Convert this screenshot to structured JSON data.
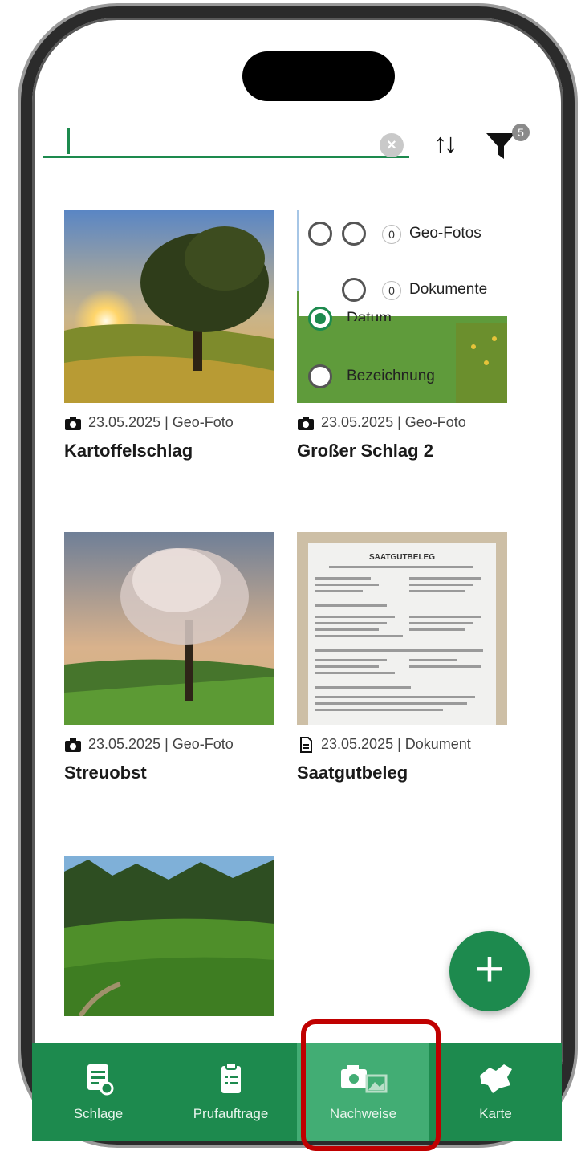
{
  "search": {
    "value": "",
    "placeholder": ""
  },
  "filter": {
    "badge_count": "5"
  },
  "sort_options": [
    {
      "label": "Datum",
      "selected": true
    },
    {
      "label": "Bezeichnung",
      "selected": false
    }
  ],
  "filter_options": [
    {
      "count": "0",
      "label": "Geo-Fotos"
    },
    {
      "count": "0",
      "label": "Dokumente"
    }
  ],
  "items": [
    {
      "meta": "23.05.2025 | Geo-Foto",
      "title": "Kartoffelschlag",
      "icon": "camera-icon"
    },
    {
      "meta": "23.05.2025 | Geo-Foto",
      "title": "Großer Schlag 2",
      "icon": "camera-icon"
    },
    {
      "meta": "23.05.2025 | Geo-Foto",
      "title": "Streuobst",
      "icon": "camera-icon"
    },
    {
      "meta": "23.05.2025 | Dokument",
      "title": "Saatgutbeleg",
      "icon": "document-icon"
    },
    {
      "meta": "",
      "title": "",
      "icon": ""
    }
  ],
  "document_preview": {
    "heading": "SAATGUTBELEG"
  },
  "nav": [
    {
      "label": "Schlage",
      "icon": "fields-list-icon",
      "active": false
    },
    {
      "label": "Prufauftrage",
      "icon": "clipboard-icon",
      "active": false
    },
    {
      "label": "Nachweise",
      "icon": "camera-gallery-icon",
      "active": true
    },
    {
      "label": "Karte",
      "icon": "map-region-icon",
      "active": false
    }
  ],
  "colors": {
    "brand": "#1d8a4e",
    "nav_active": "#42ad74",
    "highlight": "#c00000"
  }
}
